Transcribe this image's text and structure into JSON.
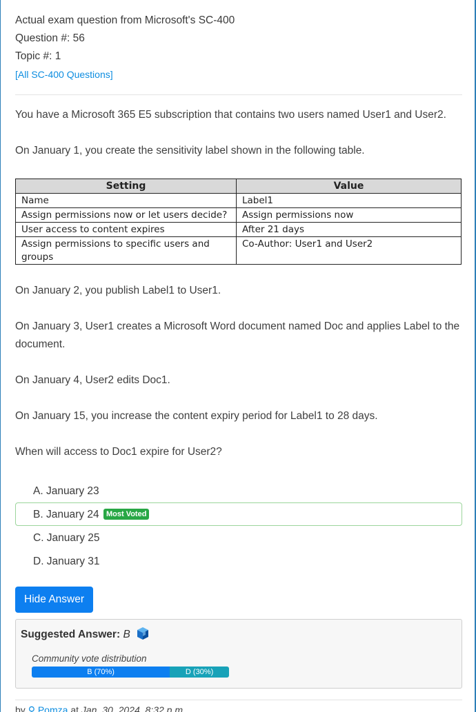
{
  "header": {
    "title": "Actual exam question from Microsoft's SC-400",
    "question_number": "Question #: 56",
    "topic": "Topic #: 1",
    "all_link": "[All SC-400 Questions]"
  },
  "question": {
    "intro": "You have a Microsoft 365 E5 subscription that contains two users named User1 and User2.",
    "table_intro": "On January 1, you create the sensitivity label shown in the following table.",
    "table": {
      "headers": [
        "Setting",
        "Value"
      ],
      "rows": [
        [
          "Name",
          "Label1"
        ],
        [
          "Assign permissions now or let users decide?",
          "Assign permissions now"
        ],
        [
          "User access to content expires",
          "After 21 days"
        ],
        [
          "Assign permissions to specific users and groups",
          "Co-Author: User1 and User2"
        ]
      ]
    },
    "p1": "On January 2, you publish Label1 to User1.",
    "p2": "On January 3, User1 creates a Microsoft Word document named Doc and applies Label to the document.",
    "p3": "On January 4, User2 edits Doc1.",
    "p4": "On January 15, you increase the content expiry period for Label1 to 28 days.",
    "prompt": "When will access to Doc1 expire for User2?"
  },
  "choices": [
    {
      "label": "A. January 23",
      "most_voted": false
    },
    {
      "label": "B. January 24",
      "most_voted": true
    },
    {
      "label": "C. January 25",
      "most_voted": false
    },
    {
      "label": "D. January 31",
      "most_voted": false
    }
  ],
  "badge": "Most Voted",
  "hide_button": "Hide Answer",
  "suggested": {
    "label": "Suggested Answer:",
    "value": "B",
    "vote_title": "Community vote distribution",
    "votes": [
      {
        "label": "B (70%)",
        "percent": 70
      },
      {
        "label": "D (30%)",
        "percent": 30
      }
    ]
  },
  "byline": {
    "by": "by",
    "user": "Pomza",
    "at": "at",
    "date": "Jan. 30, 2024, 8:32 p.m."
  },
  "colors": {
    "accent": "#0d7ff0",
    "link": "#0d8de0",
    "badge": "#28a745",
    "vote_b": "#0d7ff0",
    "vote_d": "#18a2b8",
    "frame": "#2d7fb8"
  }
}
